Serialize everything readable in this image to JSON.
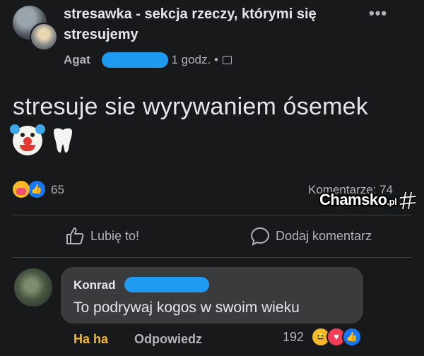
{
  "header": {
    "group_name": "stresawka - sekcja rzeczy, którymi się stresujemy",
    "author_visible": "Agat",
    "time": "• 1 godz. •",
    "more_icon": "more-horizontal-icon",
    "audience_icon": "group-icon"
  },
  "post": {
    "text": "stresuje sie wyrywaniem ósemek",
    "emojis": [
      "clown-face",
      "tooth"
    ]
  },
  "stats": {
    "reaction_icons": [
      "care-reaction",
      "like-reaction"
    ],
    "reaction_count": "65",
    "comments": "Komentarze: 74"
  },
  "watermark": {
    "text": "Chamsko",
    "suffix": ".pl"
  },
  "actions": {
    "like": "Lubię to!",
    "comment": "Dodaj komentarz"
  },
  "comment": {
    "author_visible": "Konrad",
    "text": "To podrywaj kogos w swoim wieku",
    "reaction_label": "Ha ha",
    "reply_label": "Odpowiedz",
    "reaction_count": "192",
    "reaction_icons": [
      "haha-reaction",
      "love-reaction",
      "like-reaction"
    ]
  },
  "colors": {
    "background": "#18191a",
    "redaction": "#1e9bf0",
    "haha": "#f7b928",
    "like_blue": "#1877f2"
  }
}
